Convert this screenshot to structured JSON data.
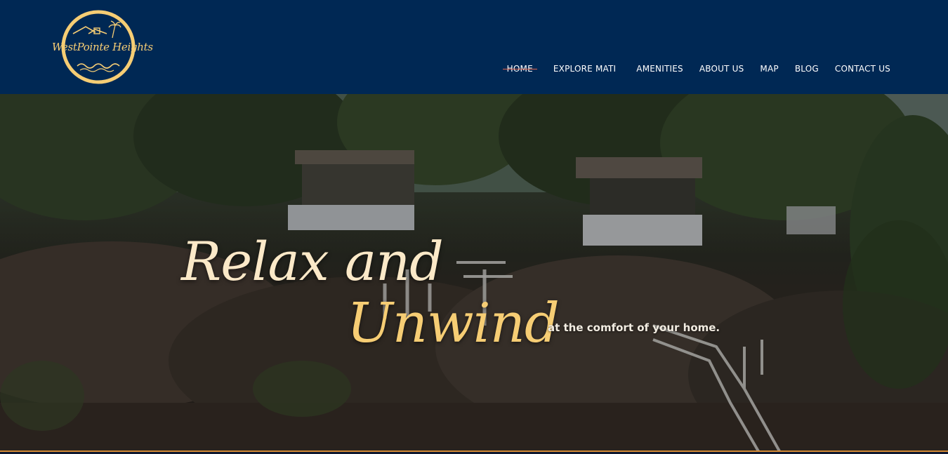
{
  "brand": {
    "logo_text": "WestPointe Heights",
    "accent_color": "#f6cd74",
    "header_bg": "#002854"
  },
  "nav": {
    "items": [
      {
        "label": "HOME",
        "active": true
      },
      {
        "label": "EXPLORE MATI",
        "active": false
      },
      {
        "label": "AMENITIES",
        "active": false
      },
      {
        "label": "ABOUT US",
        "active": false
      },
      {
        "label": "MAP",
        "active": false
      },
      {
        "label": "BLOG",
        "active": false
      },
      {
        "label": "CONTACT US",
        "active": false
      }
    ]
  },
  "hero": {
    "headline_line1": "Relax and",
    "headline_line2": "Unwind",
    "tagline": "at the comfort of your home."
  }
}
